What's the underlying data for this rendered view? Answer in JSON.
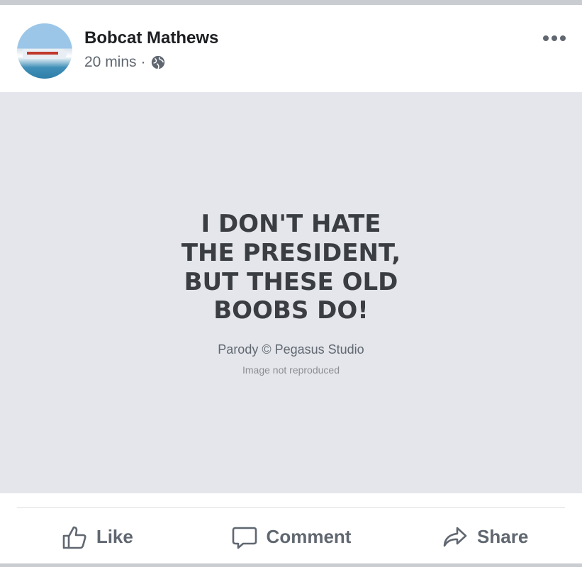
{
  "post": {
    "author": "Bobcat Mathews",
    "time": "20 mins",
    "separator": "·",
    "privacy_icon": "globe-icon",
    "more_icon": "more-icon"
  },
  "media": {
    "caption_line1": "I DON'T HATE",
    "caption_line2": "THE PRESIDENT,",
    "caption_line3": "BUT THESE OLD",
    "caption_line4": "BOOBS DO!",
    "watermark": "Parody © Pegasus Studio",
    "placeholder_note": "Image not reproduced"
  },
  "actions": {
    "like": "Like",
    "comment": "Comment",
    "share": "Share"
  },
  "colors": {
    "text_primary": "#1c1e21",
    "text_secondary": "#606770",
    "divider": "#dadde1"
  }
}
